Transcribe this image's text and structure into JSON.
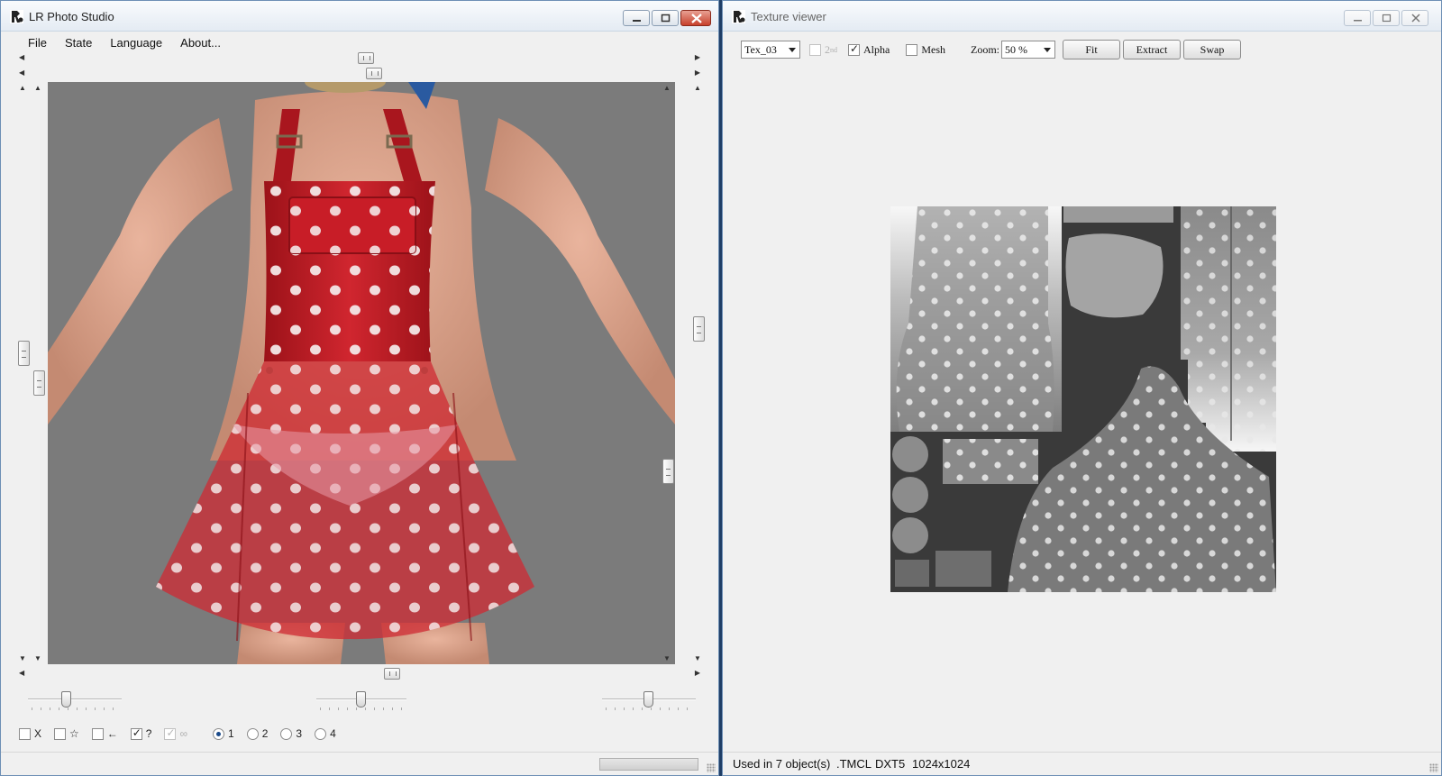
{
  "left_window": {
    "title": "LR Photo Studio",
    "menu": [
      "File",
      "State",
      "Language",
      "About..."
    ],
    "checkbox_labels": {
      "x": "X",
      "star": "☆",
      "arrow": "←",
      "question": "?",
      "infinity": "∞"
    },
    "checkbox_states": {
      "x": false,
      "star": false,
      "arrow": false,
      "question": true,
      "infinity": true
    },
    "radio_labels": [
      "1",
      "2",
      "3",
      "4"
    ],
    "radio_selected": "1"
  },
  "right_window": {
    "title": "Texture viewer",
    "texture_select": "Tex_03",
    "second_label": "2",
    "second_sup": "nd",
    "second_checked": false,
    "alpha_label": "Alpha",
    "alpha_checked": true,
    "mesh_label": "Mesh",
    "mesh_checked": false,
    "zoom_label": "Zoom:",
    "zoom_value": "50 %",
    "buttons": {
      "fit": "Fit",
      "extract": "Extract",
      "swap": "Swap"
    },
    "status": {
      "used": "Used in 7 object(s)",
      "format": ".TMCL",
      "compression": "DXT5",
      "resolution": "1024x1024"
    }
  },
  "colors": {
    "dress_red": "#c0202a",
    "viewport_gray": "#7b7b7b",
    "dot_white": "#f3e6e6"
  }
}
